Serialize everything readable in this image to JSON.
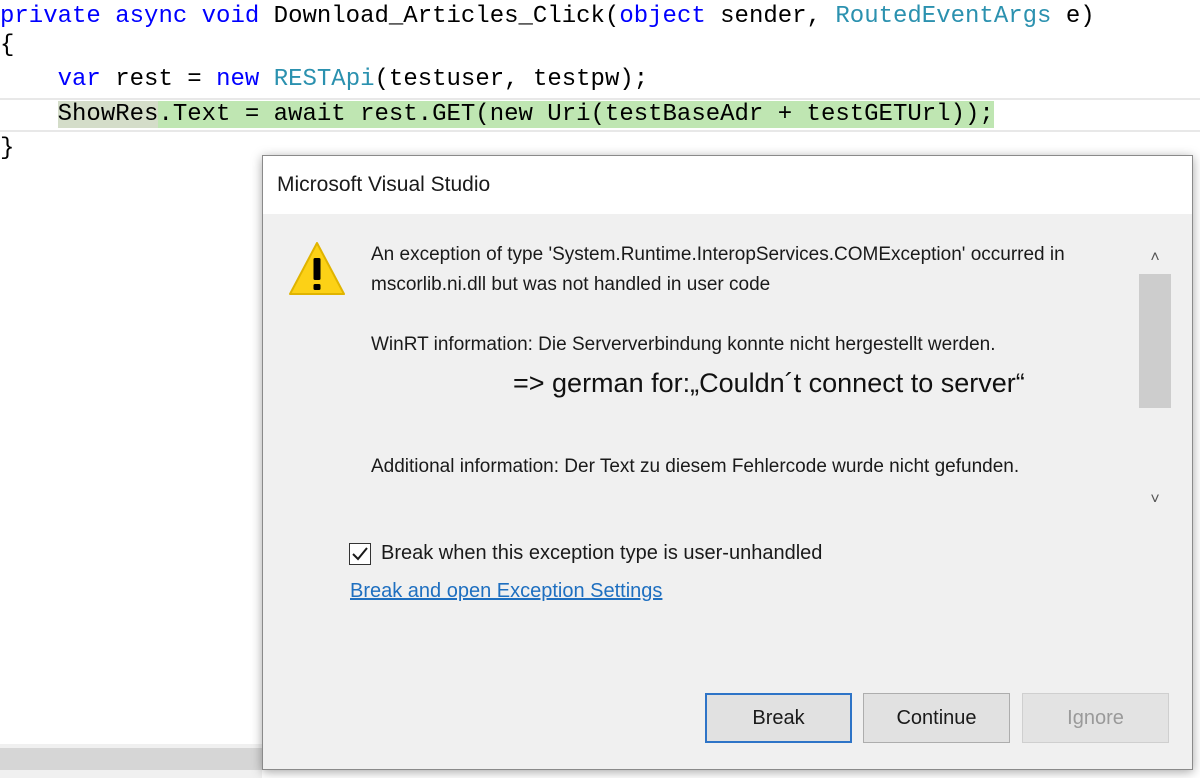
{
  "editor": {
    "line1": {
      "kw_private": "private",
      "kw_async": "async",
      "kw_void": "void",
      "method": "Download_Articles_Click(",
      "kw_object": "object",
      "sender": "sender,",
      "type_args": "RoutedEventArgs",
      "tail": "e)"
    },
    "line2": "{",
    "line3": {
      "kw_var": "var",
      "mid": "rest =",
      "kw_new": "new",
      "type_rest": "RESTApi",
      "tail": "(testuser, testpw);"
    },
    "line4": {
      "target": "ShowRes",
      "expr": ".Text = await rest.GET(new Uri(testBaseAdr + testGETUrl));"
    },
    "line5": "}"
  },
  "dialog": {
    "title": "Microsoft Visual Studio",
    "icon": "warning-icon",
    "message_p1": "An exception of type 'System.Runtime.InteropServices.COMException' occurred in mscorlib.ni.dll but was not handled in user code",
    "message_p2": "WinRT information: Die Serververbindung konnte nicht hergestellt werden.",
    "note": "=> german for:„Couldn´t connect to server“",
    "message_p3": "Additional information: Der Text zu diesem Fehlercode wurde nicht gefunden.",
    "scroll_up": "˄",
    "scroll_down": "˅",
    "checkbox_label": "Break when this exception type is user-unhandled",
    "checkbox_checked": true,
    "link_label": "Break and open Exception Settings",
    "buttons": {
      "break": "Break",
      "continue": "Continue",
      "ignore": "Ignore"
    }
  },
  "colors": {
    "keyword": "#0000ff",
    "type": "#2b91af",
    "current_statement": "#bfe6b2",
    "link": "#1e6fc0",
    "default_button_border": "#2e74c7"
  }
}
